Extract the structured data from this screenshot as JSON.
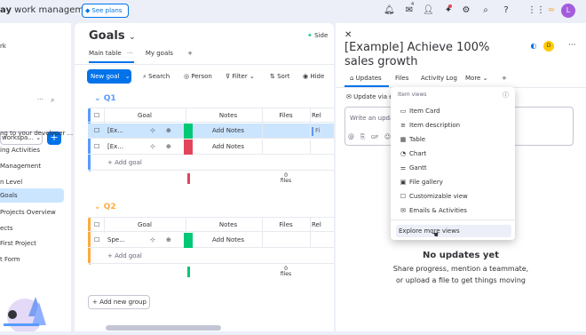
{
  "topbar": {
    "brand_bold": "ay",
    "brand_rest": " work management",
    "see_plans": "See plans",
    "inbox_badge": "4",
    "avatar_initial": "L"
  },
  "sidebar": {
    "items": [
      "rk",
      "workspa...",
      "ng to your developer ...",
      "ing Activities",
      " Management",
      "n Level",
      "Goals",
      "Projects Overview",
      "ects",
      "First Project",
      "t Form"
    ]
  },
  "board": {
    "title": "Goals",
    "tabs": [
      "Main table",
      "My goals"
    ],
    "new_item": "New goal",
    "tools": [
      "Search",
      "Person",
      "Filter",
      "Sort",
      "Hide"
    ],
    "groups": [
      {
        "name": "Q1",
        "color": "#579bfc",
        "headers": [
          "Goal",
          "Notes",
          "Files",
          "Rel"
        ],
        "rows": [
          {
            "name": "[Ex...",
            "notes": "Add Notes",
            "status_color": "#00c875",
            "files": "Fi"
          },
          {
            "name": "[Ex...",
            "notes": "Add Notes",
            "status_color": "#e2445c",
            "files": ""
          }
        ],
        "add_label": "+ Add goal",
        "summary": "0",
        "summary_unit": "files"
      },
      {
        "name": "Q2",
        "color": "#fdab3d",
        "headers": [
          "Goal",
          "Notes",
          "Files",
          "Rel"
        ],
        "rows": [
          {
            "name": "Spe...",
            "notes": "Add Notes",
            "status_color": "#00c875",
            "files": ""
          }
        ],
        "add_label": "+ Add goal",
        "summary": "0",
        "summary_unit": "files"
      }
    ],
    "add_group": "Add new group",
    "side_label": "Side"
  },
  "panel": {
    "title": "[Example] Achieve 100% sales growth",
    "tabs": [
      "Updates",
      "Files",
      "Activity Log",
      "More"
    ],
    "update_via": "Update via e",
    "write_update": "Write an update",
    "no_updates": "No updates yet",
    "no_updates_sub1": "Share progress, mention a teammate,",
    "no_updates_sub2": "or upload a file to get things moving"
  },
  "dropdown": {
    "header": "Item views",
    "items": [
      "Item Card",
      "Item description",
      "Table",
      "Chart",
      "Gantt",
      "File gallery",
      "Customizable view",
      "Emails & Activities"
    ],
    "explore": "Explore more views"
  }
}
